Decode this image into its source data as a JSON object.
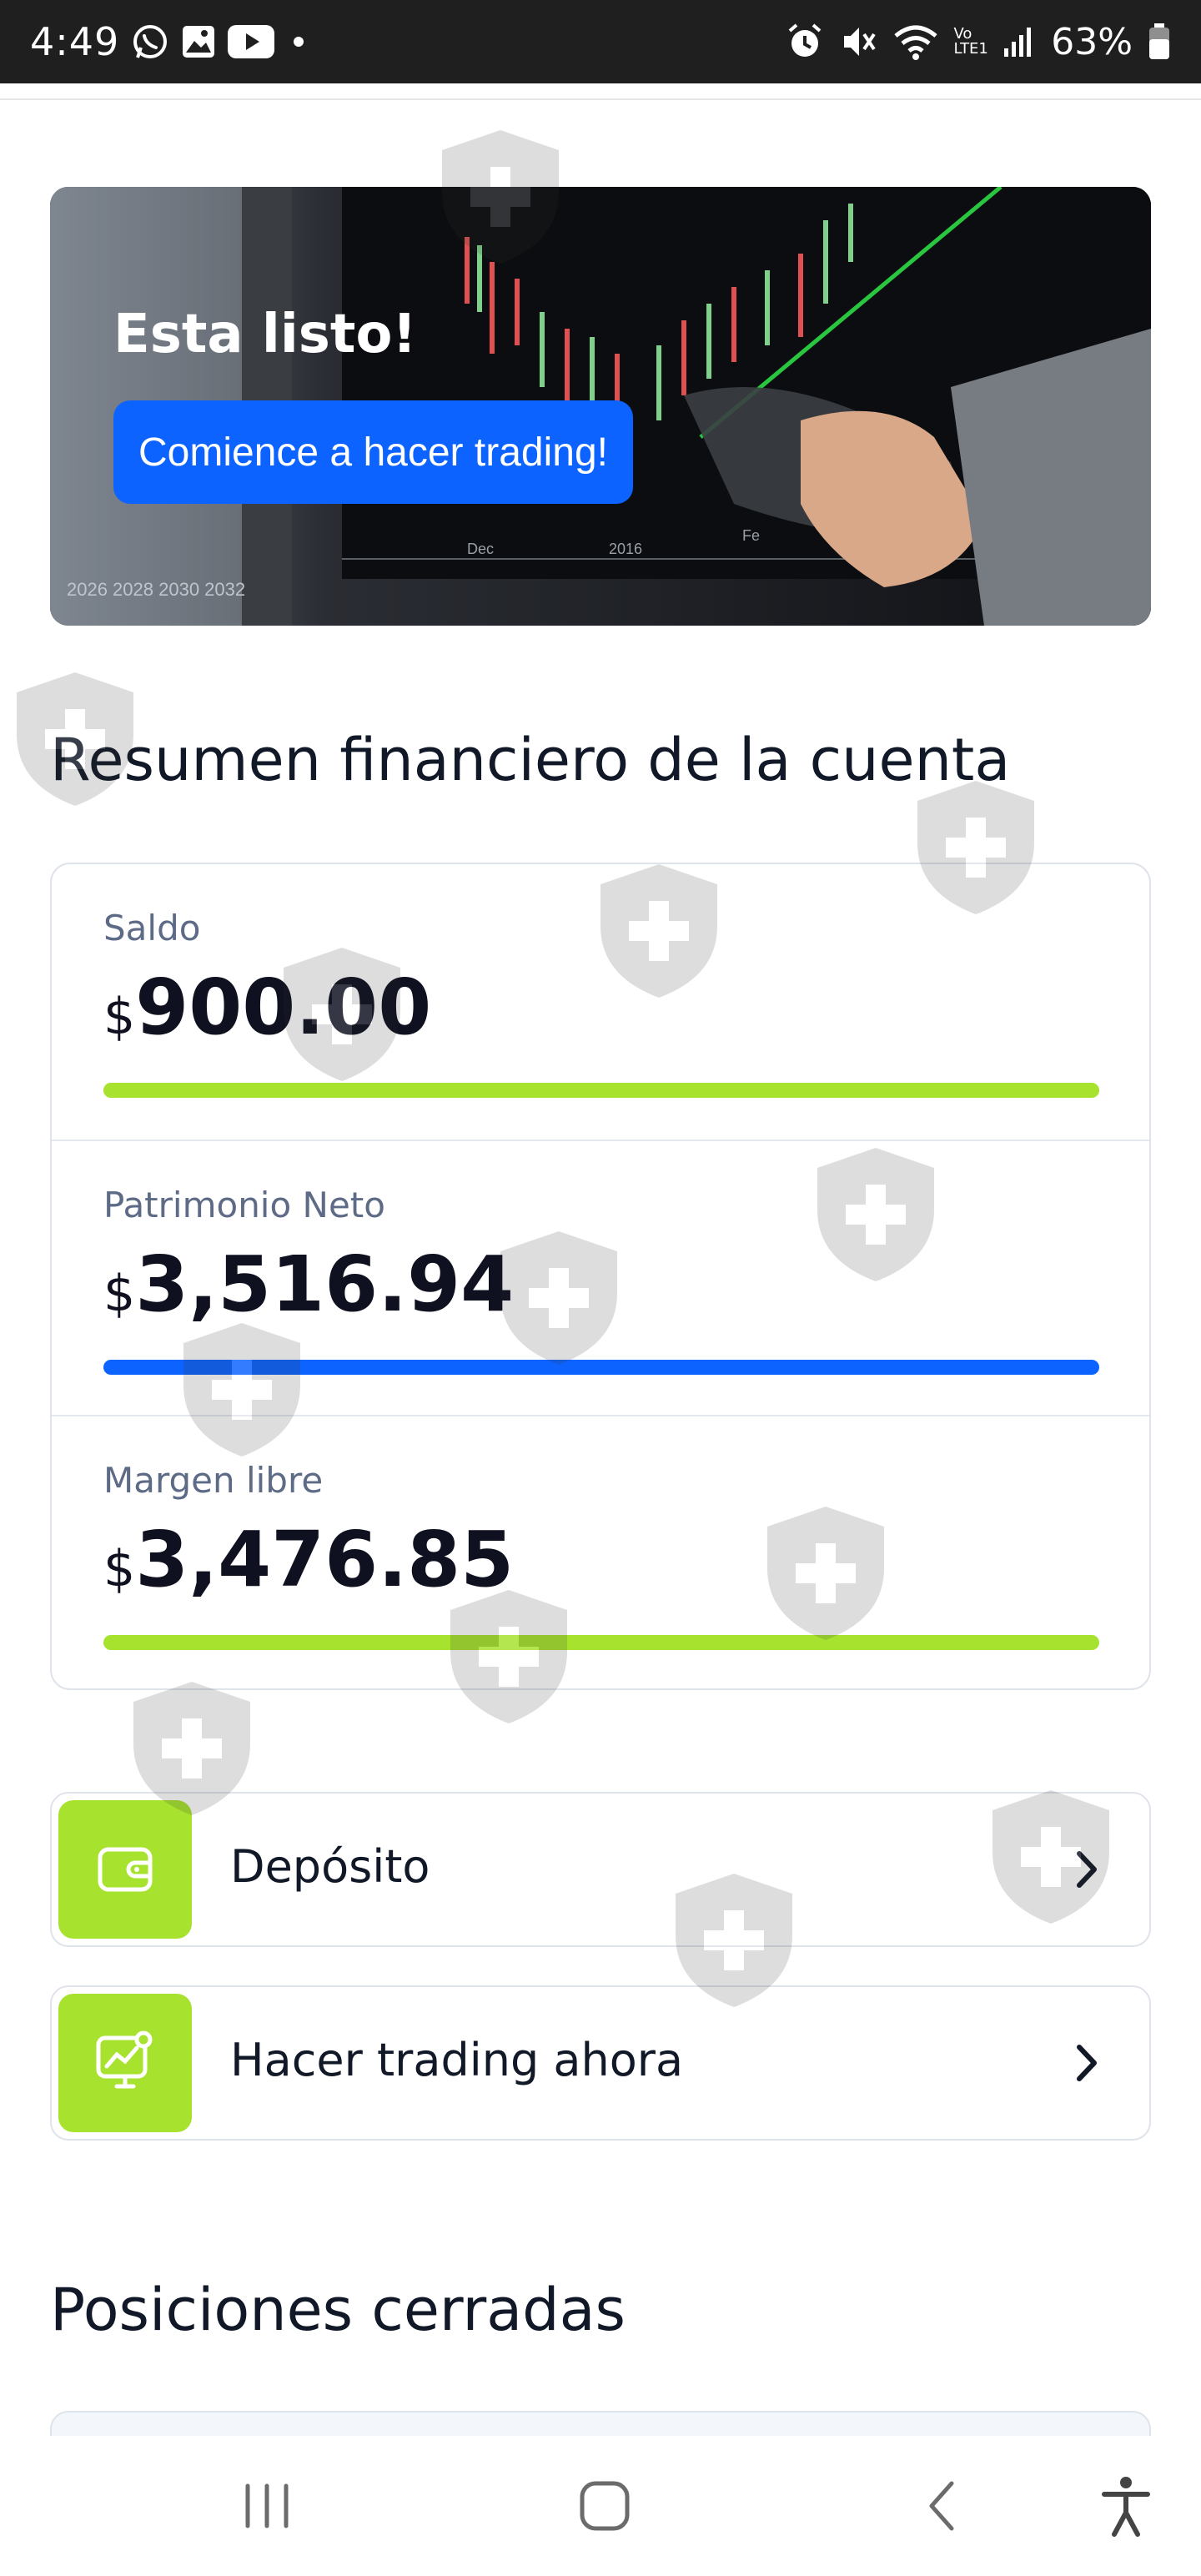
{
  "status_bar": {
    "time": "4:49",
    "battery": "63%",
    "network_label": "Vo LTE1"
  },
  "banner": {
    "title": "Esta listo!",
    "cta_label": "Comience a hacer trading!",
    "axis_labels": [
      "Dec",
      "2016",
      "Fe"
    ],
    "wall_text": "2026 2028 2030 2032"
  },
  "account_summary": {
    "title": "Resumen financiero de la cuenta",
    "currency_symbol": "$",
    "metrics": [
      {
        "label": "Saldo",
        "value": "900.00",
        "bar_color": "#a6e22e"
      },
      {
        "label": "Patrimonio Neto",
        "value": "3,516.94",
        "bar_color": "#0d63ff"
      },
      {
        "label": "Margen libre",
        "value": "3,476.85",
        "bar_color": "#a6e22e"
      }
    ]
  },
  "actions": [
    {
      "label": "Depósito",
      "icon": "wallet-icon"
    },
    {
      "label": "Hacer trading ahora",
      "icon": "trading-chart-icon"
    }
  ],
  "closed_positions": {
    "title": "Posiciones cerradas"
  },
  "colors": {
    "accent_green": "#a6e22e",
    "accent_blue": "#0d63ff",
    "text_primary": "#111827",
    "text_muted": "#5d6b86"
  }
}
